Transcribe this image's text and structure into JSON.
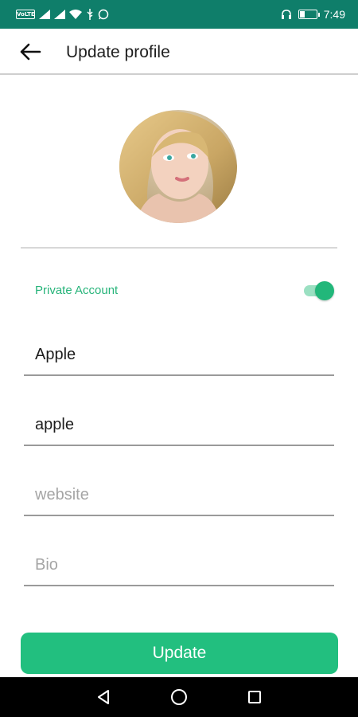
{
  "status_bar": {
    "network_badge": "VoLTE",
    "time": "7:49",
    "battery_level": 0.3,
    "icons": [
      "volte-icon",
      "signal-icon",
      "signal-icon",
      "wifi-icon",
      "usb-icon",
      "whatsapp-icon",
      "headset-icon",
      "battery-icon"
    ]
  },
  "header": {
    "back_icon": "arrow-left-icon",
    "title": "Update profile"
  },
  "profile": {
    "avatar": "profile-photo"
  },
  "privacy": {
    "label": "Private Account",
    "enabled": true
  },
  "form": {
    "name": {
      "value": "Apple",
      "placeholder": ""
    },
    "username": {
      "value": "apple",
      "placeholder": ""
    },
    "website": {
      "value": "",
      "placeholder": "website"
    },
    "bio": {
      "value": "",
      "placeholder": "Bio"
    }
  },
  "actions": {
    "update_label": "Update"
  },
  "nav_bar": {
    "icons": [
      "back-triangle-icon",
      "home-circle-icon",
      "recents-square-icon"
    ]
  },
  "colors": {
    "status_bar": "#0f7e6a",
    "accent": "#22bf7f",
    "toggle_track": "#9be0c2",
    "label_green": "#27b47a"
  }
}
